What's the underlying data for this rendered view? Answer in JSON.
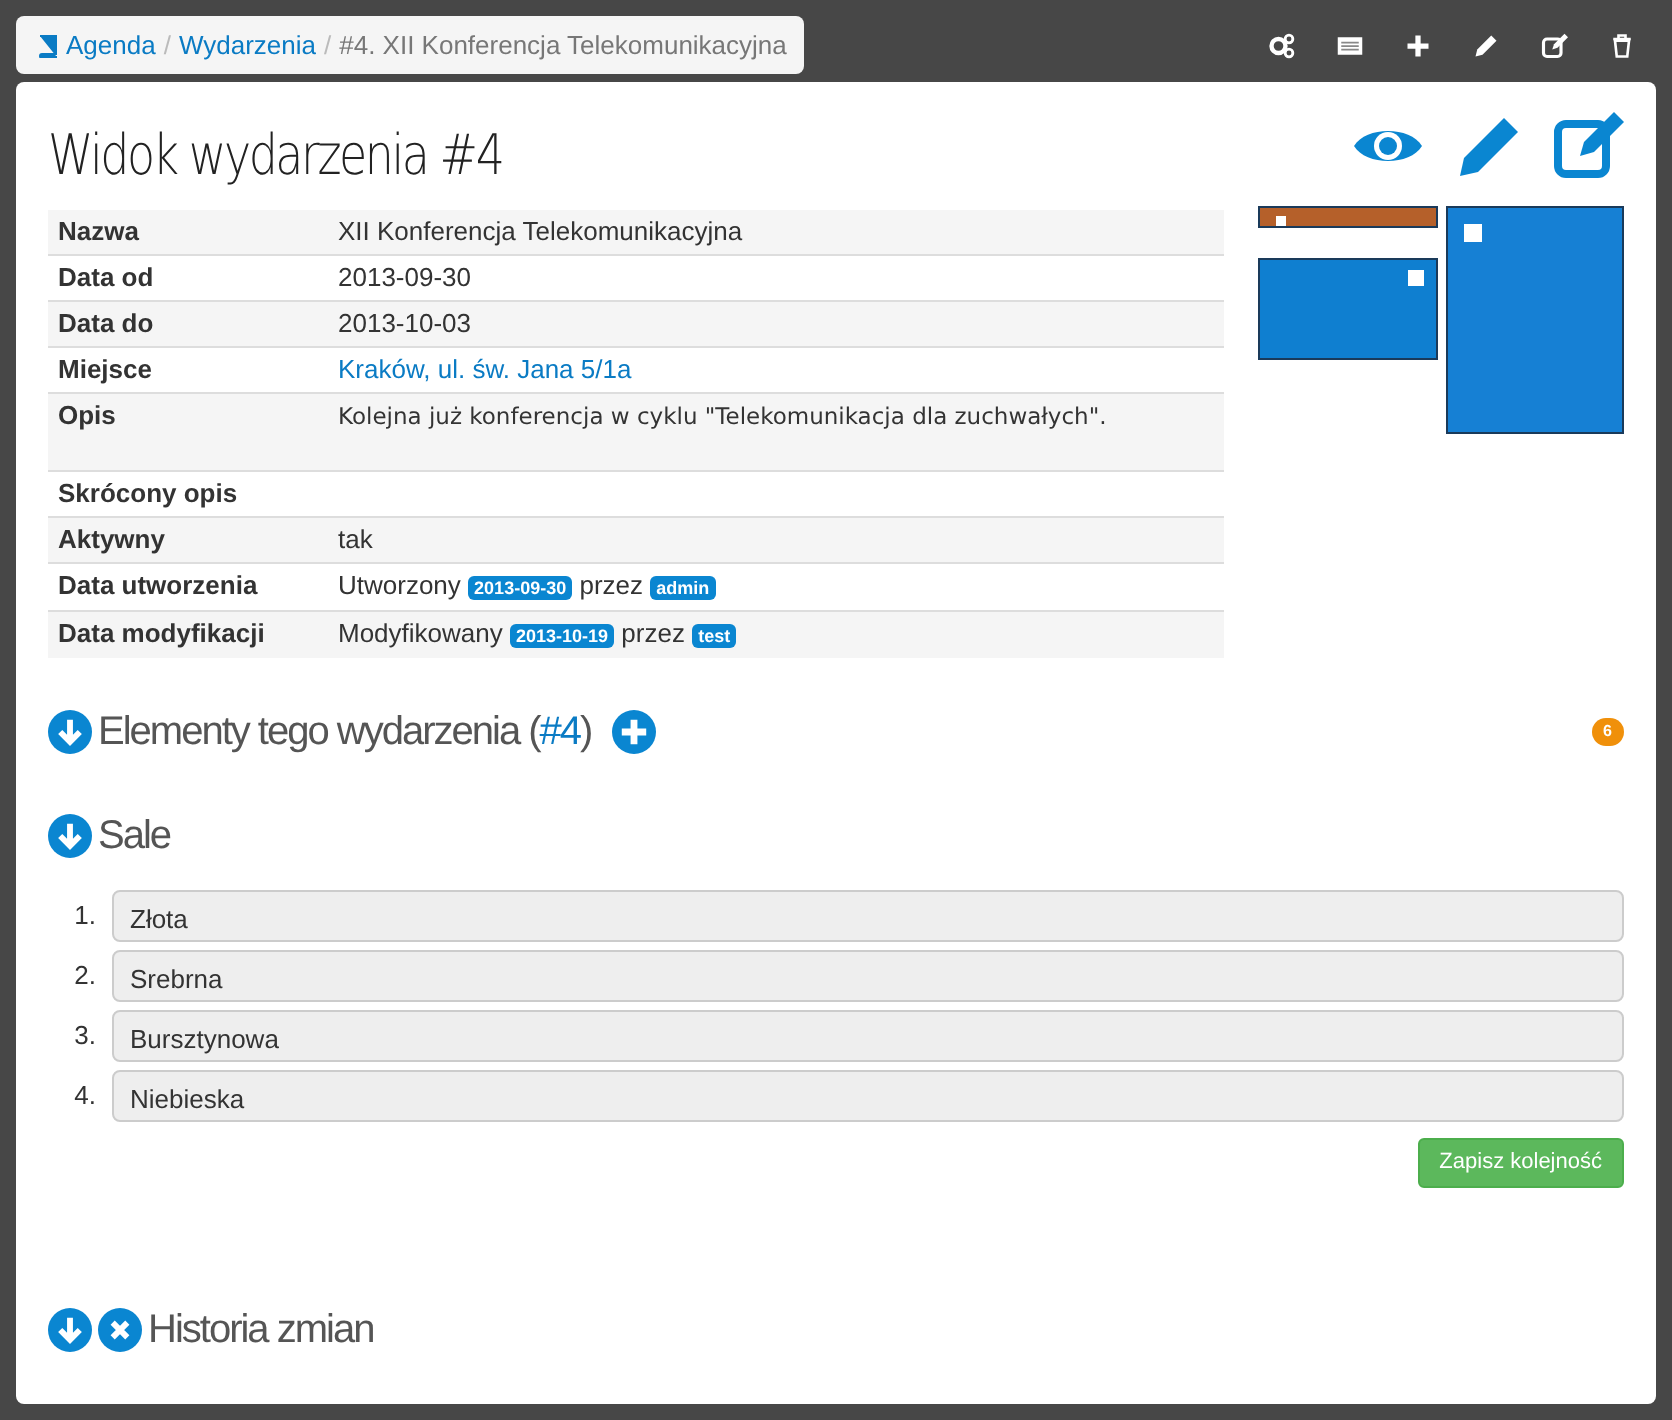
{
  "breadcrumb": [
    {
      "text": "Agenda",
      "kind": "link"
    },
    {
      "text": "/",
      "kind": "separator"
    },
    {
      "text": "Wydarzenia",
      "kind": "link"
    },
    {
      "text": "/",
      "kind": "separator"
    },
    {
      "text": "#4. XII Konferencja Telekomunikacyjna",
      "kind": "current"
    }
  ],
  "title": "Widok wydarzenia #4",
  "details": [
    {
      "label": "Nazwa",
      "value": [
        {
          "kind": "text",
          "text": "XII Konferencja Telekomunikacyjna"
        }
      ]
    },
    {
      "label": "Data od",
      "value": [
        {
          "kind": "text",
          "text": "2013-09-30"
        }
      ]
    },
    {
      "label": "Data do",
      "value": [
        {
          "kind": "text",
          "text": "2013-10-03"
        }
      ]
    },
    {
      "label": "Miejsce",
      "value": [
        {
          "kind": "link",
          "text": "Kraków, ul. św. Jana 5/1a"
        }
      ]
    },
    {
      "label": "Opis",
      "value": [
        {
          "kind": "note",
          "text": "Kolejna już konferencja w cyklu \"Telekomunikacja dla zuchwałych\"."
        }
      ]
    },
    {
      "label": "Skrócony opis"
    },
    {
      "label": "Aktywny",
      "value": [
        {
          "kind": "text",
          "text": "tak"
        }
      ]
    },
    {
      "label": "Data utworzenia",
      "value": [
        {
          "kind": "text",
          "text": "Utworzony"
        },
        {
          "kind": "badge",
          "text": "2013-09-30"
        },
        {
          "kind": "text",
          "text": "przez"
        },
        {
          "kind": "badge",
          "text": "admin"
        }
      ]
    },
    {
      "label": "Data modyfikacji",
      "value": [
        {
          "kind": "text",
          "text": "Modyfikowany"
        },
        {
          "kind": "badge",
          "text": "2013-10-19"
        },
        {
          "kind": "text",
          "text": "przez"
        },
        {
          "kind": "badge",
          "text": "test"
        }
      ]
    }
  ],
  "thumbnails": [
    {
      "kind": "strip",
      "color": "#b5602a"
    },
    {
      "kind": "landscape",
      "color": "#0f7fd0"
    },
    {
      "kind": "portrait",
      "color": "#1680d4"
    }
  ],
  "sections": [
    {
      "title": "Elementy tego wydarzenia (",
      "link": "#4",
      "title_end": ")",
      "count": "6"
    },
    {
      "title": "Sale",
      "items": [
        {
          "number": "1.",
          "text": "Złota"
        },
        {
          "number": "2.",
          "text": "Srebrna"
        },
        {
          "number": "3.",
          "text": "Bursztynowa"
        },
        {
          "number": "4.",
          "text": "Niebieska"
        }
      ],
      "button": "Zapisz kolejność"
    },
    {
      "title": "Historia zmian"
    }
  ]
}
